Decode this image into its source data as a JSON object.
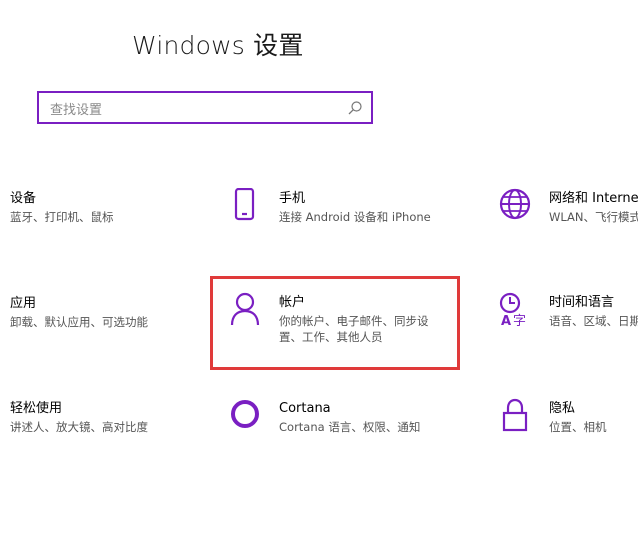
{
  "window": {
    "title": "Windows 设置"
  },
  "search": {
    "placeholder": "查找设置"
  },
  "tiles": [
    {
      "id": "devices",
      "title": "设备",
      "desc": [
        "蓝牙、打印机、鼠标"
      ],
      "icon": "devices-icon"
    },
    {
      "id": "phone",
      "title": "手机",
      "desc": [
        "连接 Android 设备和 iPhone"
      ],
      "icon": "phone-icon"
    },
    {
      "id": "network",
      "title": "网络和 Internet",
      "desc": [
        "WLAN、飞行模式、VPN"
      ],
      "icon": "globe-icon"
    },
    {
      "id": "apps",
      "title": "应用",
      "desc": [
        "卸载、默认应用、可选功能"
      ],
      "icon": "apps-icon"
    },
    {
      "id": "accounts",
      "title": "帐户",
      "desc": [
        "你的帐户、电子邮件、同步设",
        "置、工作、其他人员"
      ],
      "icon": "person-icon"
    },
    {
      "id": "time-language",
      "title": "时间和语言",
      "desc": [
        "语音、区域、日期"
      ],
      "icon": "time-language-icon"
    },
    {
      "id": "ease-of-access",
      "title": "轻松使用",
      "desc": [
        "讲述人、放大镜、高对比度"
      ],
      "icon": "ease-of-access-icon"
    },
    {
      "id": "cortana",
      "title": "Cortana",
      "desc": [
        "Cortana 语言、权限、通知"
      ],
      "icon": "cortana-icon"
    },
    {
      "id": "privacy",
      "title": "隐私",
      "desc": [
        "位置、相机"
      ],
      "icon": "lock-icon"
    }
  ],
  "colors": {
    "accent": "#7a1fc2",
    "highlight": "#e03a3a"
  }
}
